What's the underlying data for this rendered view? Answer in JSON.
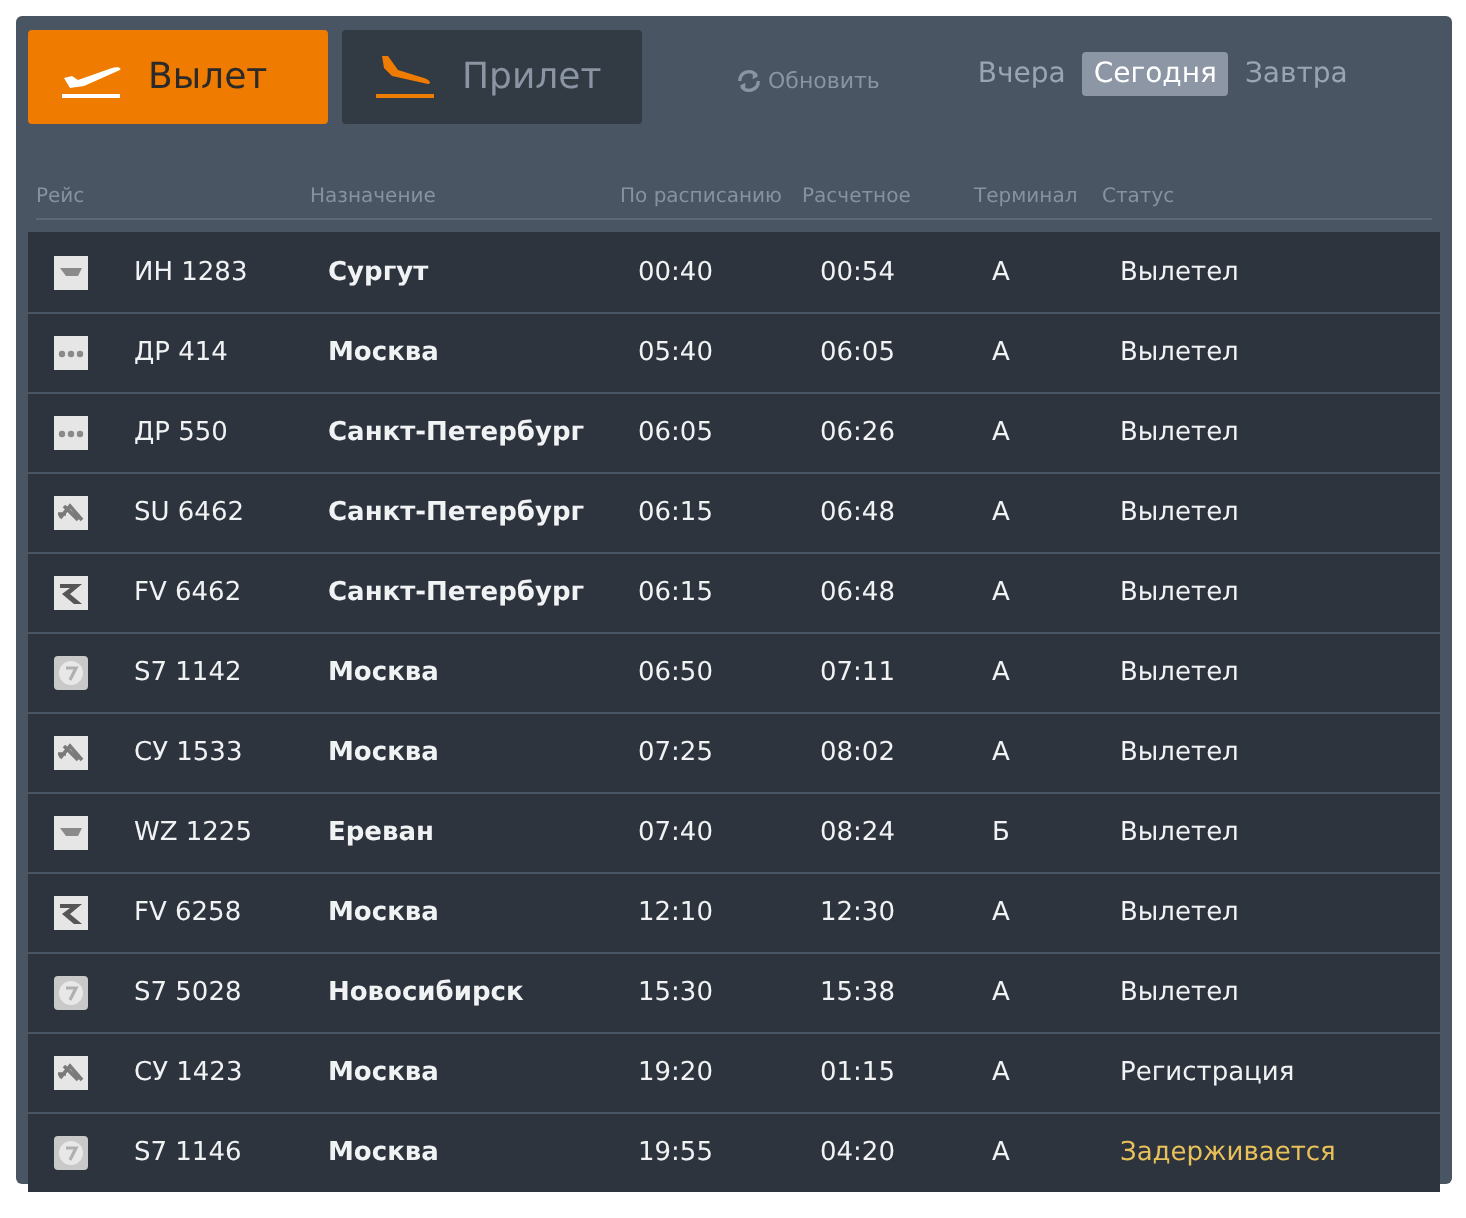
{
  "direction_tabs": [
    {
      "label": "Вылет",
      "kind": "departure",
      "selected": true
    },
    {
      "label": "Прилет",
      "kind": "arrival",
      "selected": false
    }
  ],
  "refresh": {
    "label": "Обновить"
  },
  "day_tabs": [
    {
      "label": "Вчера",
      "selected": false
    },
    {
      "label": "Сегодня",
      "selected": true
    },
    {
      "label": "Завтра",
      "selected": false
    }
  ],
  "table": {
    "columns": [
      "Рейс",
      "Назначение",
      "По расписанию",
      "Расчетное",
      "Терминал",
      "Статус"
    ],
    "rows": [
      {
        "kind": "wing",
        "flight": "ИН 1283",
        "destination": "Сургут",
        "scheduled": "00:40",
        "estimated": "00:54",
        "terminal": "A",
        "status": "Вылетел",
        "delayed": false
      },
      {
        "kind": "dots",
        "flight": "ДР 414",
        "destination": "Москва",
        "scheduled": "05:40",
        "estimated": "06:05",
        "terminal": "A",
        "status": "Вылетел",
        "delayed": false
      },
      {
        "kind": "dots",
        "flight": "ДР 550",
        "destination": "Санкт-Петербург",
        "scheduled": "06:05",
        "estimated": "06:26",
        "terminal": "A",
        "status": "Вылетел",
        "delayed": false
      },
      {
        "kind": "emblem",
        "flight": "SU 6462",
        "destination": "Санкт-Петербург",
        "scheduled": "06:15",
        "estimated": "06:48",
        "terminal": "A",
        "status": "Вылетел",
        "delayed": false
      },
      {
        "kind": "swoosh",
        "flight": "FV 6462",
        "destination": "Санкт-Петербург",
        "scheduled": "06:15",
        "estimated": "06:48",
        "terminal": "A",
        "status": "Вылетел",
        "delayed": false
      },
      {
        "kind": "circle",
        "flight": "S7 1142",
        "destination": "Москва",
        "scheduled": "06:50",
        "estimated": "07:11",
        "terminal": "A",
        "status": "Вылетел",
        "delayed": false
      },
      {
        "kind": "emblem",
        "flight": "СУ 1533",
        "destination": "Москва",
        "scheduled": "07:25",
        "estimated": "08:02",
        "terminal": "A",
        "status": "Вылетел",
        "delayed": false
      },
      {
        "kind": "wing",
        "flight": "WZ 1225",
        "destination": "Ереван",
        "scheduled": "07:40",
        "estimated": "08:24",
        "terminal": "Б",
        "status": "Вылетел",
        "delayed": false
      },
      {
        "kind": "swoosh",
        "flight": "FV 6258",
        "destination": "Москва",
        "scheduled": "12:10",
        "estimated": "12:30",
        "terminal": "A",
        "status": "Вылетел",
        "delayed": false
      },
      {
        "kind": "circle",
        "flight": "S7 5028",
        "destination": "Новосибирск",
        "scheduled": "15:30",
        "estimated": "15:38",
        "terminal": "A",
        "status": "Вылетел",
        "delayed": false
      },
      {
        "kind": "emblem",
        "flight": "СУ 1423",
        "destination": "Москва",
        "scheduled": "19:20",
        "estimated": "01:15",
        "terminal": "A",
        "status": "Регистрация",
        "delayed": false
      },
      {
        "kind": "circle",
        "flight": "S7 1146",
        "destination": "Москва",
        "scheduled": "19:55",
        "estimated": "04:20",
        "terminal": "A",
        "status": "Задерживается",
        "delayed": true
      }
    ]
  }
}
